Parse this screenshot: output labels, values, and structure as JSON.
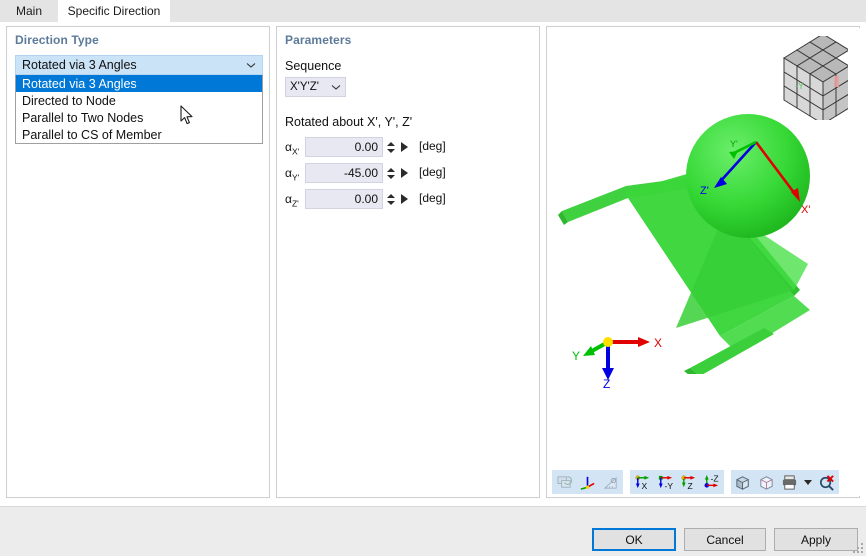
{
  "tabs": [
    {
      "label": "Main",
      "active": false
    },
    {
      "label": "Specific Direction",
      "active": true
    }
  ],
  "direction_type": {
    "title": "Direction Type",
    "selected": "Rotated via 3 Angles",
    "options": [
      "Rotated via 3 Angles",
      "Directed to Node",
      "Parallel to Two Nodes",
      "Parallel to CS of Member"
    ]
  },
  "parameters": {
    "title": "Parameters",
    "sequence_label": "Sequence",
    "sequence_value": "X'Y'Z'",
    "rotated_about_label": "Rotated about X', Y', Z'",
    "angles": [
      {
        "symbol": "α",
        "sub": "X'",
        "value": "0.00",
        "unit": "[deg]"
      },
      {
        "symbol": "α",
        "sub": "Y'",
        "value": "-45.00",
        "unit": "[deg]"
      },
      {
        "symbol": "α",
        "sub": "Z'",
        "value": "0.00",
        "unit": "[deg]"
      }
    ]
  },
  "viewport": {
    "nav_cube_label": "-Y",
    "global_axes": [
      {
        "name": "X",
        "color": "#e00000"
      },
      {
        "name": "Y",
        "color": "#00c000"
      },
      {
        "name": "Z",
        "color": "#0000e0"
      }
    ],
    "local_axes": [
      {
        "name": "X'",
        "color": "#e00000"
      },
      {
        "name": "Y'",
        "color": "#00c000"
      },
      {
        "name": "Z'",
        "color": "#0000e0"
      }
    ],
    "model_color": "#33d633",
    "toolbar": [
      {
        "name": "reset-view-icon",
        "label": "",
        "disabled": true
      },
      {
        "name": "show-axes-icon",
        "label": "",
        "disabled": false
      },
      {
        "name": "measure-icon",
        "label": "",
        "disabled": true
      },
      {
        "name": "view-in-x-icon",
        "label": "X",
        "disabled": false
      },
      {
        "name": "view-in-negative-y-icon",
        "label": "-Y",
        "disabled": false
      },
      {
        "name": "view-in-z-icon",
        "label": "Z",
        "disabled": false
      },
      {
        "name": "view-in-negative-z-icon",
        "label": "-Z",
        "disabled": false
      },
      {
        "name": "isometric-view-icon",
        "label": "",
        "disabled": false
      },
      {
        "name": "wireframe-view-icon",
        "label": "",
        "disabled": false
      },
      {
        "name": "print-icon",
        "label": "",
        "disabled": false
      },
      {
        "name": "zoom-reset-icon",
        "label": "",
        "disabled": false
      }
    ]
  },
  "footer": {
    "ok_label": "OK",
    "cancel_label": "Cancel",
    "apply_label": "Apply"
  },
  "colors": {
    "accent": "#0078d7",
    "selection": "#0078d7",
    "combo_highlight": "#cbe3f7",
    "panel_title": "#5c7a99",
    "toolbar_bg": "#d3e4f5",
    "footer_bg": "#ececec"
  }
}
